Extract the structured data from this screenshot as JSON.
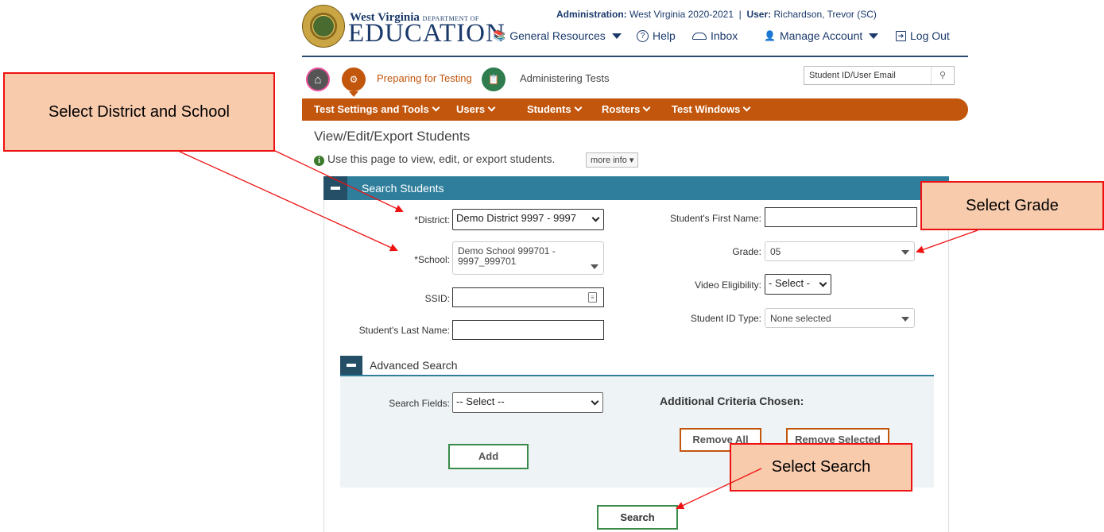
{
  "header": {
    "logo_top": "West Virginia",
    "logo_dept": "DEPARTMENT OF",
    "logo_main": "EDUCATION",
    "admin_label": "Administration:",
    "admin_value": "West Virginia 2020-2021",
    "user_label": "User:",
    "user_value": "Richardson, Trevor (SC)",
    "nav": {
      "general_resources": "General Resources",
      "help": "Help",
      "inbox": "Inbox",
      "manage_account": "Manage Account",
      "log_out": "Log Out"
    }
  },
  "roles": {
    "preparing": "Preparing for Testing",
    "administering": "Administering Tests",
    "search_placeholder": "Student ID/User Email"
  },
  "menu": [
    "Test Settings and Tools",
    "Users",
    "Students",
    "Rosters",
    "Test Windows"
  ],
  "page": {
    "title": "View/Edit/Export Students",
    "info": "Use this page to view, edit, or export students.",
    "more_info": "more info"
  },
  "search_panel": {
    "title": "Search Students",
    "district_label": "*District:",
    "district_value": "Demo District 9997 - 9997",
    "school_label": "*School:",
    "school_value_line1": "Demo School 999701 -",
    "school_value_line2": "9997_999701",
    "ssid_label": "SSID:",
    "last_name_label": "Student's Last Name:",
    "first_name_label": "Student's First Name:",
    "grade_label": "Grade:",
    "grade_value": "05",
    "video_label": "Video Eligibility:",
    "video_value": "- Select -",
    "id_type_label": "Student ID Type:",
    "id_type_value": "None selected"
  },
  "advanced": {
    "title": "Advanced Search",
    "fields_label": "Search Fields:",
    "fields_value": "-- Select --",
    "criteria_label": "Additional Criteria Chosen:",
    "add": "Add",
    "remove_all": "Remove All",
    "remove_selected": "Remove Selected"
  },
  "search_button": "Search",
  "callouts": {
    "district_school": "Select District and School",
    "grade": "Select Grade",
    "search": "Select Search"
  },
  "colors": {
    "menu_orange": "#c2560c",
    "panel_teal": "#2f7f9c",
    "navy": "#1b3a6b",
    "callout_fill": "#f8cbad",
    "callout_border": "#ee1111"
  }
}
